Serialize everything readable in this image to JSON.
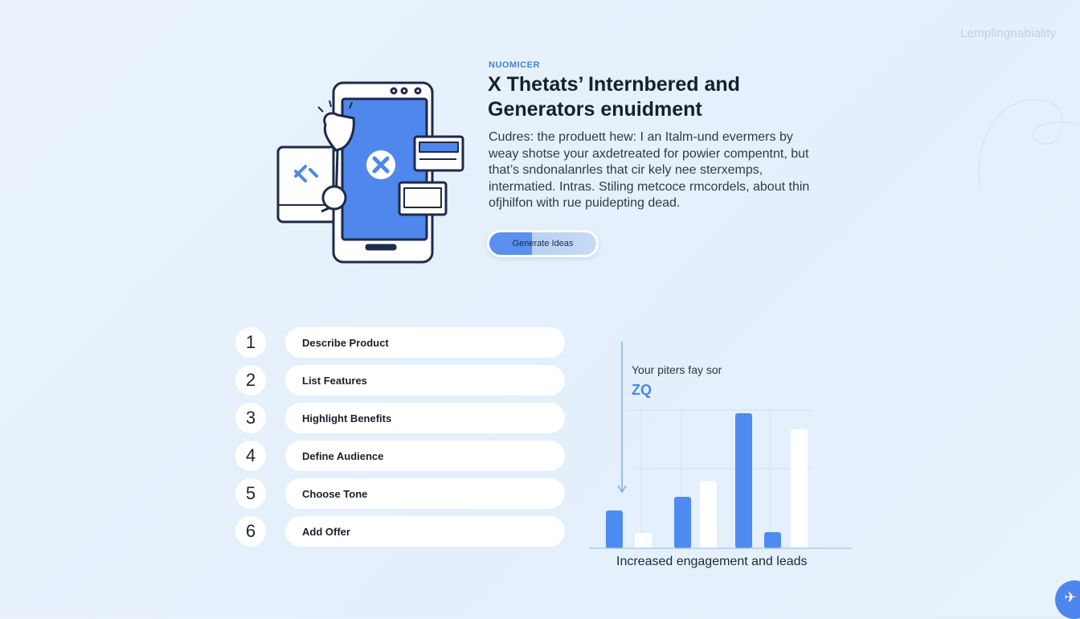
{
  "brand": {
    "text": "Lemplingnabiality"
  },
  "hero": {
    "eyebrow": "NUOMICER",
    "title": "X Thetats’ Internbered and Generators enuidment",
    "description": "Cudres: the produett hew: I an Italm-und evermers by weay shotse your axdetreated for powier compentnt, but that’s sndonalanrles that cir kely nee sterxemps, intermatied. Intras. Stiling metcoce rmcordels, about thin ofjhilfon with rue puidepting dead.",
    "cta_label": "Generate Ideas"
  },
  "steps": [
    {
      "number": "1",
      "label": "Describe Product"
    },
    {
      "number": "2",
      "label": "List Features"
    },
    {
      "number": "3",
      "label": "Highlight Benefits"
    },
    {
      "number": "4",
      "label": "Define Audience"
    },
    {
      "number": "5",
      "label": "Choose Tone"
    },
    {
      "number": "6",
      "label": "Add Offer"
    }
  ],
  "chart_data": {
    "type": "bar",
    "label": "Your piters fay sor",
    "value_text": "ZQ",
    "caption": "Increased engagement and leads",
    "values": [
      47,
      19,
      64,
      84,
      168,
      20,
      148
    ],
    "colors": [
      "#4d8bf0",
      "#ffffff",
      "#4d8bf0",
      "#ffffff",
      "#4d8bf0",
      "#4d8bf0",
      "#ffffff"
    ],
    "grid": true
  },
  "colors": {
    "accent": "#4d8bf0",
    "background": "#e6f0fb"
  },
  "fab": {
    "icon": "plane-icon"
  }
}
